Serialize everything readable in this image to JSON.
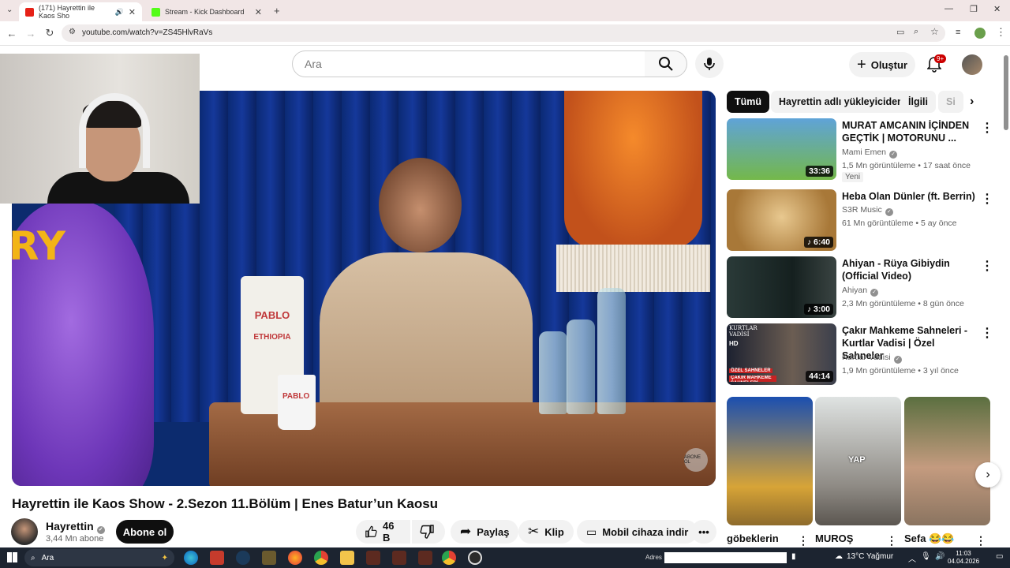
{
  "browser": {
    "tabs": [
      {
        "title": "(171) Hayrettin ile Kaos Sho",
        "active": true
      },
      {
        "title": "Stream - Kick Dashboard",
        "active": false
      }
    ],
    "url": "youtube.com/watch?v=ZS45HlvRaVs"
  },
  "header": {
    "search_placeholder": "Ara",
    "create_label": "Oluştur",
    "notif_count": "9+"
  },
  "video": {
    "title": "Hayrettin ile Kaos Show - 2.Sezon 11.Bölüm | Enes Batur’un Kaosu",
    "channel": "Hayrettin",
    "subscribers": "3,44 Mn abone",
    "subscribe_label": "Abone ol",
    "likes": "46 B",
    "share_label": "Paylaş",
    "clip_label": "Klip",
    "download_label": "Mobil cihaza indir",
    "overlay": {
      "mascot_text": "RY",
      "bag_brand": "PABLO",
      "bag_origin": "ETHIOPIA",
      "cup_text": "PABLO",
      "watermark": "ABONE OL"
    }
  },
  "filters": [
    "Tümü",
    "Hayrettin adlı yükleyiciden",
    "İlgili",
    "Si"
  ],
  "recommendations": [
    {
      "title": "MURAT AMCANIN İÇİNDEN GEÇTİK | MOTORUNU ...",
      "channel": "Mami Emen",
      "verified": true,
      "meta": "1,5 Mn görüntüleme • 17 saat önce",
      "duration": "33:36",
      "badge": "Yeni",
      "thumb_color": "#5fa3d8"
    },
    {
      "title": "Heba Olan Dünler (ft. Berrin)",
      "channel": "S3R Music",
      "verified": true,
      "meta": "61 Mn görüntüleme • 5 ay önce",
      "duration": "♪ 6:40",
      "thumb_color": "#c49a58"
    },
    {
      "title": "Ahiyan - Rüya Gibiydin (Official Video)",
      "channel": "Ahiyan",
      "verified": true,
      "meta": "2,3 Mn görüntüleme • 8 gün önce",
      "duration": "♪ 3:00",
      "thumb_color": "#1f2c2b"
    },
    {
      "title": "Çakır Mahkeme Sahneleri - Kurtlar Vadisi | Özel Sahneler",
      "channel": "Kurtlar Vadisi",
      "verified": true,
      "meta": "1,9 Mn görüntüleme • 3 yıl önce",
      "duration": "44:14",
      "thumb_color": "#3a3f4a",
      "thumb_text_1": "KURTLAR VADİSİ",
      "thumb_text_2": "HD",
      "thumb_text_3": "ÖZEL SAHNELER",
      "thumb_text_4": "ÇAKIR MAHKEME SAHNELERİ"
    }
  ],
  "shorts": [
    {
      "title": "göbeklerin",
      "color": "#1b4fb0",
      "overlay": ""
    },
    {
      "title": "MUROŞ",
      "color": "#b8b2a8",
      "overlay": "YAP"
    },
    {
      "title": "Sefa 😂😂",
      "color": "#6b7a56",
      "overlay": ""
    }
  ],
  "taskbar": {
    "search_label": "Ara",
    "address_label": "Adres",
    "weather": "13°C  Yağmur",
    "time": "11:03",
    "date": "04.04.2026"
  }
}
